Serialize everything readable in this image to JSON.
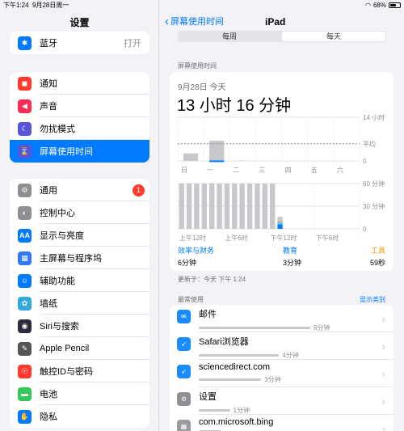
{
  "status": {
    "time": "下午1:24",
    "date": "9月28日周一",
    "battery": "68%"
  },
  "sidebar": {
    "title": "设置",
    "group1": [
      {
        "icon": "bluetooth-icon",
        "glyph": "✱",
        "color": "#007aff",
        "label": "蓝牙",
        "value": "打开"
      }
    ],
    "group2": [
      {
        "icon": "notifications-icon",
        "glyph": "◼",
        "color": "#ff3b30",
        "label": "通知"
      },
      {
        "icon": "sounds-icon",
        "glyph": "◀",
        "color": "#ff2d55",
        "label": "声音"
      },
      {
        "icon": "do-not-disturb-icon",
        "glyph": "☾",
        "color": "#5856d6",
        "label": "勿扰模式"
      },
      {
        "icon": "screen-time-icon",
        "glyph": "⌛",
        "color": "#5856d6",
        "label": "屏幕使用时间",
        "selected": true
      }
    ],
    "group3": [
      {
        "icon": "general-icon",
        "glyph": "⚙",
        "color": "#8e8e93",
        "label": "通用",
        "badge": "1"
      },
      {
        "icon": "control-center-icon",
        "glyph": "◐",
        "color": "#8e8e93",
        "label": "控制中心"
      },
      {
        "icon": "display-brightness-icon",
        "glyph": "AA",
        "color": "#007aff",
        "label": "显示与亮度"
      },
      {
        "icon": "home-screen-dock-icon",
        "glyph": "▦",
        "color": "#3478f6",
        "label": "主屏幕与程序坞"
      },
      {
        "icon": "accessibility-icon",
        "glyph": "☺",
        "color": "#007aff",
        "label": "辅助功能"
      },
      {
        "icon": "wallpaper-icon",
        "glyph": "✿",
        "color": "#34aadc",
        "label": "墙纸"
      },
      {
        "icon": "siri-icon",
        "glyph": "◉",
        "color": "#2c2c3a",
        "label": "Siri与搜索"
      },
      {
        "icon": "apple-pencil-icon",
        "glyph": "✎",
        "color": "#555555",
        "label": "Apple Pencil"
      },
      {
        "icon": "touch-id-icon",
        "glyph": "☉",
        "color": "#ff3b30",
        "label": "触控ID与密码"
      },
      {
        "icon": "battery-icon",
        "glyph": "▬",
        "color": "#34c759",
        "label": "电池"
      },
      {
        "icon": "privacy-icon",
        "glyph": "✋",
        "color": "#007aff",
        "label": "隐私"
      }
    ]
  },
  "main": {
    "back_label": "屏幕使用时间",
    "title": "iPad",
    "segments": [
      "每周",
      "每天"
    ],
    "section_label": "屏幕使用时间",
    "date_label": "9月28日 今天",
    "total": "13 小时 16 分钟",
    "categories": [
      {
        "name": "效率与财务",
        "time": "6分钟",
        "color": "#007aff"
      },
      {
        "name": "教育",
        "time": "3分钟",
        "color": "#007aff"
      },
      {
        "name": "工具",
        "time": "59秒",
        "color": "#ff9500"
      }
    ],
    "updated": "更新于：今天 下午 1:24",
    "most_used_label": "最常使用",
    "show_categories": "显示类别",
    "apps": [
      {
        "icon": "mail-icon",
        "glyph": "✉",
        "color": "#1a8cff",
        "name": "邮件",
        "duration": "6分钟",
        "fraction": 1.0
      },
      {
        "icon": "safari-icon",
        "glyph": "➶",
        "color": "#1a8cff",
        "name": "Safari浏览器",
        "duration": "4分钟",
        "fraction": 0.72
      },
      {
        "icon": "safari-icon",
        "glyph": "➶",
        "color": "#1a8cff",
        "name": "sciencedirect.com",
        "duration": "3分钟",
        "fraction": 0.56
      },
      {
        "icon": "settings-icon",
        "glyph": "⚙",
        "color": "#8e8e93",
        "name": "设置",
        "duration": "1分钟",
        "fraction": 0.28
      },
      {
        "icon": "website-icon",
        "glyph": "▦",
        "color": "#9a9a9f",
        "name": "com.microsoft.bing",
        "duration": "",
        "fraction": 0.2
      }
    ]
  },
  "chart_data": [
    {
      "type": "bar",
      "categories": [
        "日",
        "一",
        "二",
        "三",
        "四",
        "五",
        "六"
      ],
      "values": [
        2.4,
        6.5,
        0.1,
        0,
        0,
        0,
        0
      ],
      "ylabels": [
        "14 小时",
        "平均",
        "0"
      ],
      "ylim": [
        0,
        14
      ],
      "average_label": "平均",
      "average_value": 5.5,
      "grid": true
    },
    {
      "type": "bar",
      "xlabels": [
        "上午12时",
        "上午6时",
        "下午12时",
        "下午6时"
      ],
      "ylabels": [
        "60 分钟",
        "30 分钟",
        "0"
      ],
      "ylim": [
        0,
        60
      ],
      "hours": [
        0,
        1,
        2,
        3,
        4,
        5,
        6,
        7,
        8,
        9,
        10,
        11,
        12,
        13
      ],
      "values": [
        60,
        60,
        60,
        60,
        60,
        60,
        60,
        60,
        60,
        60,
        60,
        60,
        60,
        16
      ],
      "segments_last": {
        "blue": 6,
        "light_blue": 3,
        "orange": 1
      },
      "grid": true
    }
  ]
}
